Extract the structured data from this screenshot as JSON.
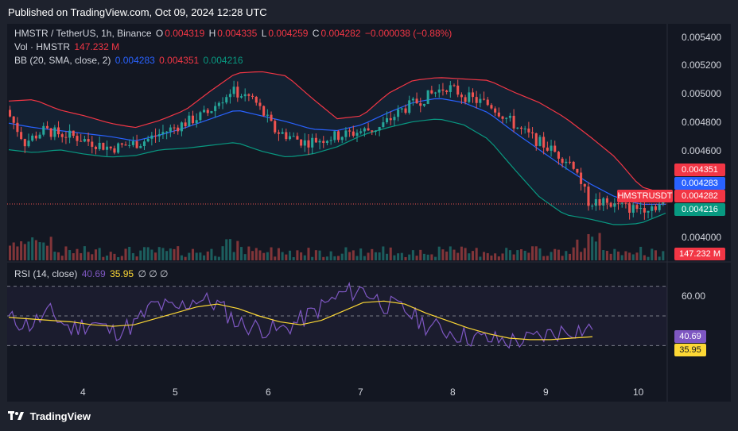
{
  "header": {
    "published": "Published on TradingView.com, Oct 09, 2024 12:28 UTC"
  },
  "legend": {
    "symbol": "HMSTR / TetherUS, 1h, Binance",
    "o_label": "O",
    "o_val": "0.004319",
    "h_label": "H",
    "h_val": "0.004335",
    "l_label": "L",
    "l_val": "0.004259",
    "c_label": "C",
    "c_val": "0.004282",
    "change": "−0.000038 (−0.88%)",
    "vol_label": "Vol · HMSTR",
    "vol_val": "147.232 M",
    "bb_label": "BB (20, SMA, close, 2)",
    "bb_basis": "0.004283",
    "bb_upper": "0.004351",
    "bb_lower": "0.004216",
    "rsi_label": "RSI (14, close)",
    "rsi_val": "40.69",
    "rsi_ma": "35.95",
    "rsi_extra": "∅ ∅ ∅"
  },
  "price_axis": [
    "0.005400",
    "0.005200",
    "0.005000",
    "0.004800",
    "0.004600",
    "0.004000"
  ],
  "price_tags": {
    "upper": "0.004351",
    "basis": "0.004283",
    "symbol": "HMSTRUSDT",
    "last": "0.004282",
    "lower": "0.004216",
    "volume": "147.232 M"
  },
  "rsi_axis": [
    "60.00"
  ],
  "rsi_tags": {
    "rsi": "40.69",
    "ma": "35.95"
  },
  "time_axis": [
    "4",
    "5",
    "6",
    "7",
    "8",
    "9",
    "10"
  ],
  "footer": {
    "brand": "TradingView"
  },
  "colors": {
    "up": "#26a69a",
    "down": "#ef5350",
    "basis": "#2962ff",
    "upper": "#f23645",
    "lower": "#089981",
    "rsi": "#7e57c2",
    "rsi_ma": "#fdd835"
  },
  "chart_data": {
    "type": "candlestick",
    "title": "HMSTR / TetherUS, 1h, Binance",
    "y_range": [
      0.0039,
      0.00545
    ],
    "x_ticks": [
      "4",
      "5",
      "6",
      "7",
      "8",
      "9",
      "10"
    ],
    "price_path": [
      {
        "t": 0,
        "p": 0.00492
      },
      {
        "t": 5,
        "p": 0.0047
      },
      {
        "t": 10,
        "p": 0.00478
      },
      {
        "t": 18,
        "p": 0.00474
      },
      {
        "t": 28,
        "p": 0.00466
      },
      {
        "t": 36,
        "p": 0.0047
      },
      {
        "t": 45,
        "p": 0.0048
      },
      {
        "t": 54,
        "p": 0.0049
      },
      {
        "t": 60,
        "p": 0.00505
      },
      {
        "t": 66,
        "p": 0.005
      },
      {
        "t": 72,
        "p": 0.00478
      },
      {
        "t": 80,
        "p": 0.0047
      },
      {
        "t": 90,
        "p": 0.00475
      },
      {
        "t": 100,
        "p": 0.0048
      },
      {
        "t": 106,
        "p": 0.00492
      },
      {
        "t": 112,
        "p": 0.005
      },
      {
        "t": 118,
        "p": 0.00508
      },
      {
        "t": 124,
        "p": 0.005
      },
      {
        "t": 130,
        "p": 0.00495
      },
      {
        "t": 138,
        "p": 0.00478
      },
      {
        "t": 146,
        "p": 0.00465
      },
      {
        "t": 152,
        "p": 0.00455
      },
      {
        "t": 156,
        "p": 0.0043
      },
      {
        "t": 162,
        "p": 0.00428
      },
      {
        "t": 168,
        "p": 0.00425
      },
      {
        "t": 176,
        "p": 0.00428
      }
    ],
    "bb_upper": [
      0.00498,
      0.00499,
      0.00492,
      0.00488,
      0.00483,
      0.0048,
      0.00485,
      0.00492,
      0.00505,
      0.00517,
      0.00518,
      0.00515,
      0.005,
      0.00486,
      0.00488,
      0.00503,
      0.00512,
      0.00514,
      0.00513,
      0.00512,
      0.00504,
      0.00497,
      0.00487,
      0.00474,
      0.0046,
      0.0044,
      0.00435
    ],
    "bb_basis": [
      0.00483,
      0.0048,
      0.00478,
      0.00476,
      0.00474,
      0.00471,
      0.00475,
      0.0048,
      0.00486,
      0.00492,
      0.00488,
      0.00484,
      0.00479,
      0.00478,
      0.00482,
      0.0049,
      0.00497,
      0.005,
      0.00497,
      0.0049,
      0.00477,
      0.00465,
      0.00453,
      0.00442,
      0.00433,
      0.00428,
      0.00428
    ],
    "bb_lower": [
      0.00465,
      0.00463,
      0.00465,
      0.00462,
      0.0046,
      0.00461,
      0.00465,
      0.00466,
      0.00468,
      0.0047,
      0.00464,
      0.0046,
      0.00462,
      0.00467,
      0.00475,
      0.0048,
      0.00484,
      0.00486,
      0.00482,
      0.00472,
      0.00452,
      0.00433,
      0.00421,
      0.00418,
      0.00414,
      0.00415,
      0.00422
    ],
    "rsi": [
      48,
      44,
      52,
      41,
      46,
      39,
      44,
      58,
      54,
      62,
      58,
      45,
      42,
      40,
      47,
      56,
      65,
      68,
      58,
      54,
      44,
      40,
      36,
      34,
      33,
      34,
      38,
      41,
      40.69
    ],
    "rsi_ma": [
      49,
      48,
      47,
      46,
      44,
      43,
      44,
      48,
      52,
      56,
      58,
      55,
      50,
      46,
      44,
      47,
      53,
      59,
      60,
      58,
      52,
      47,
      42,
      38,
      35,
      34,
      34,
      35,
      35.95
    ],
    "rsi_levels": [
      70,
      50,
      30
    ]
  }
}
